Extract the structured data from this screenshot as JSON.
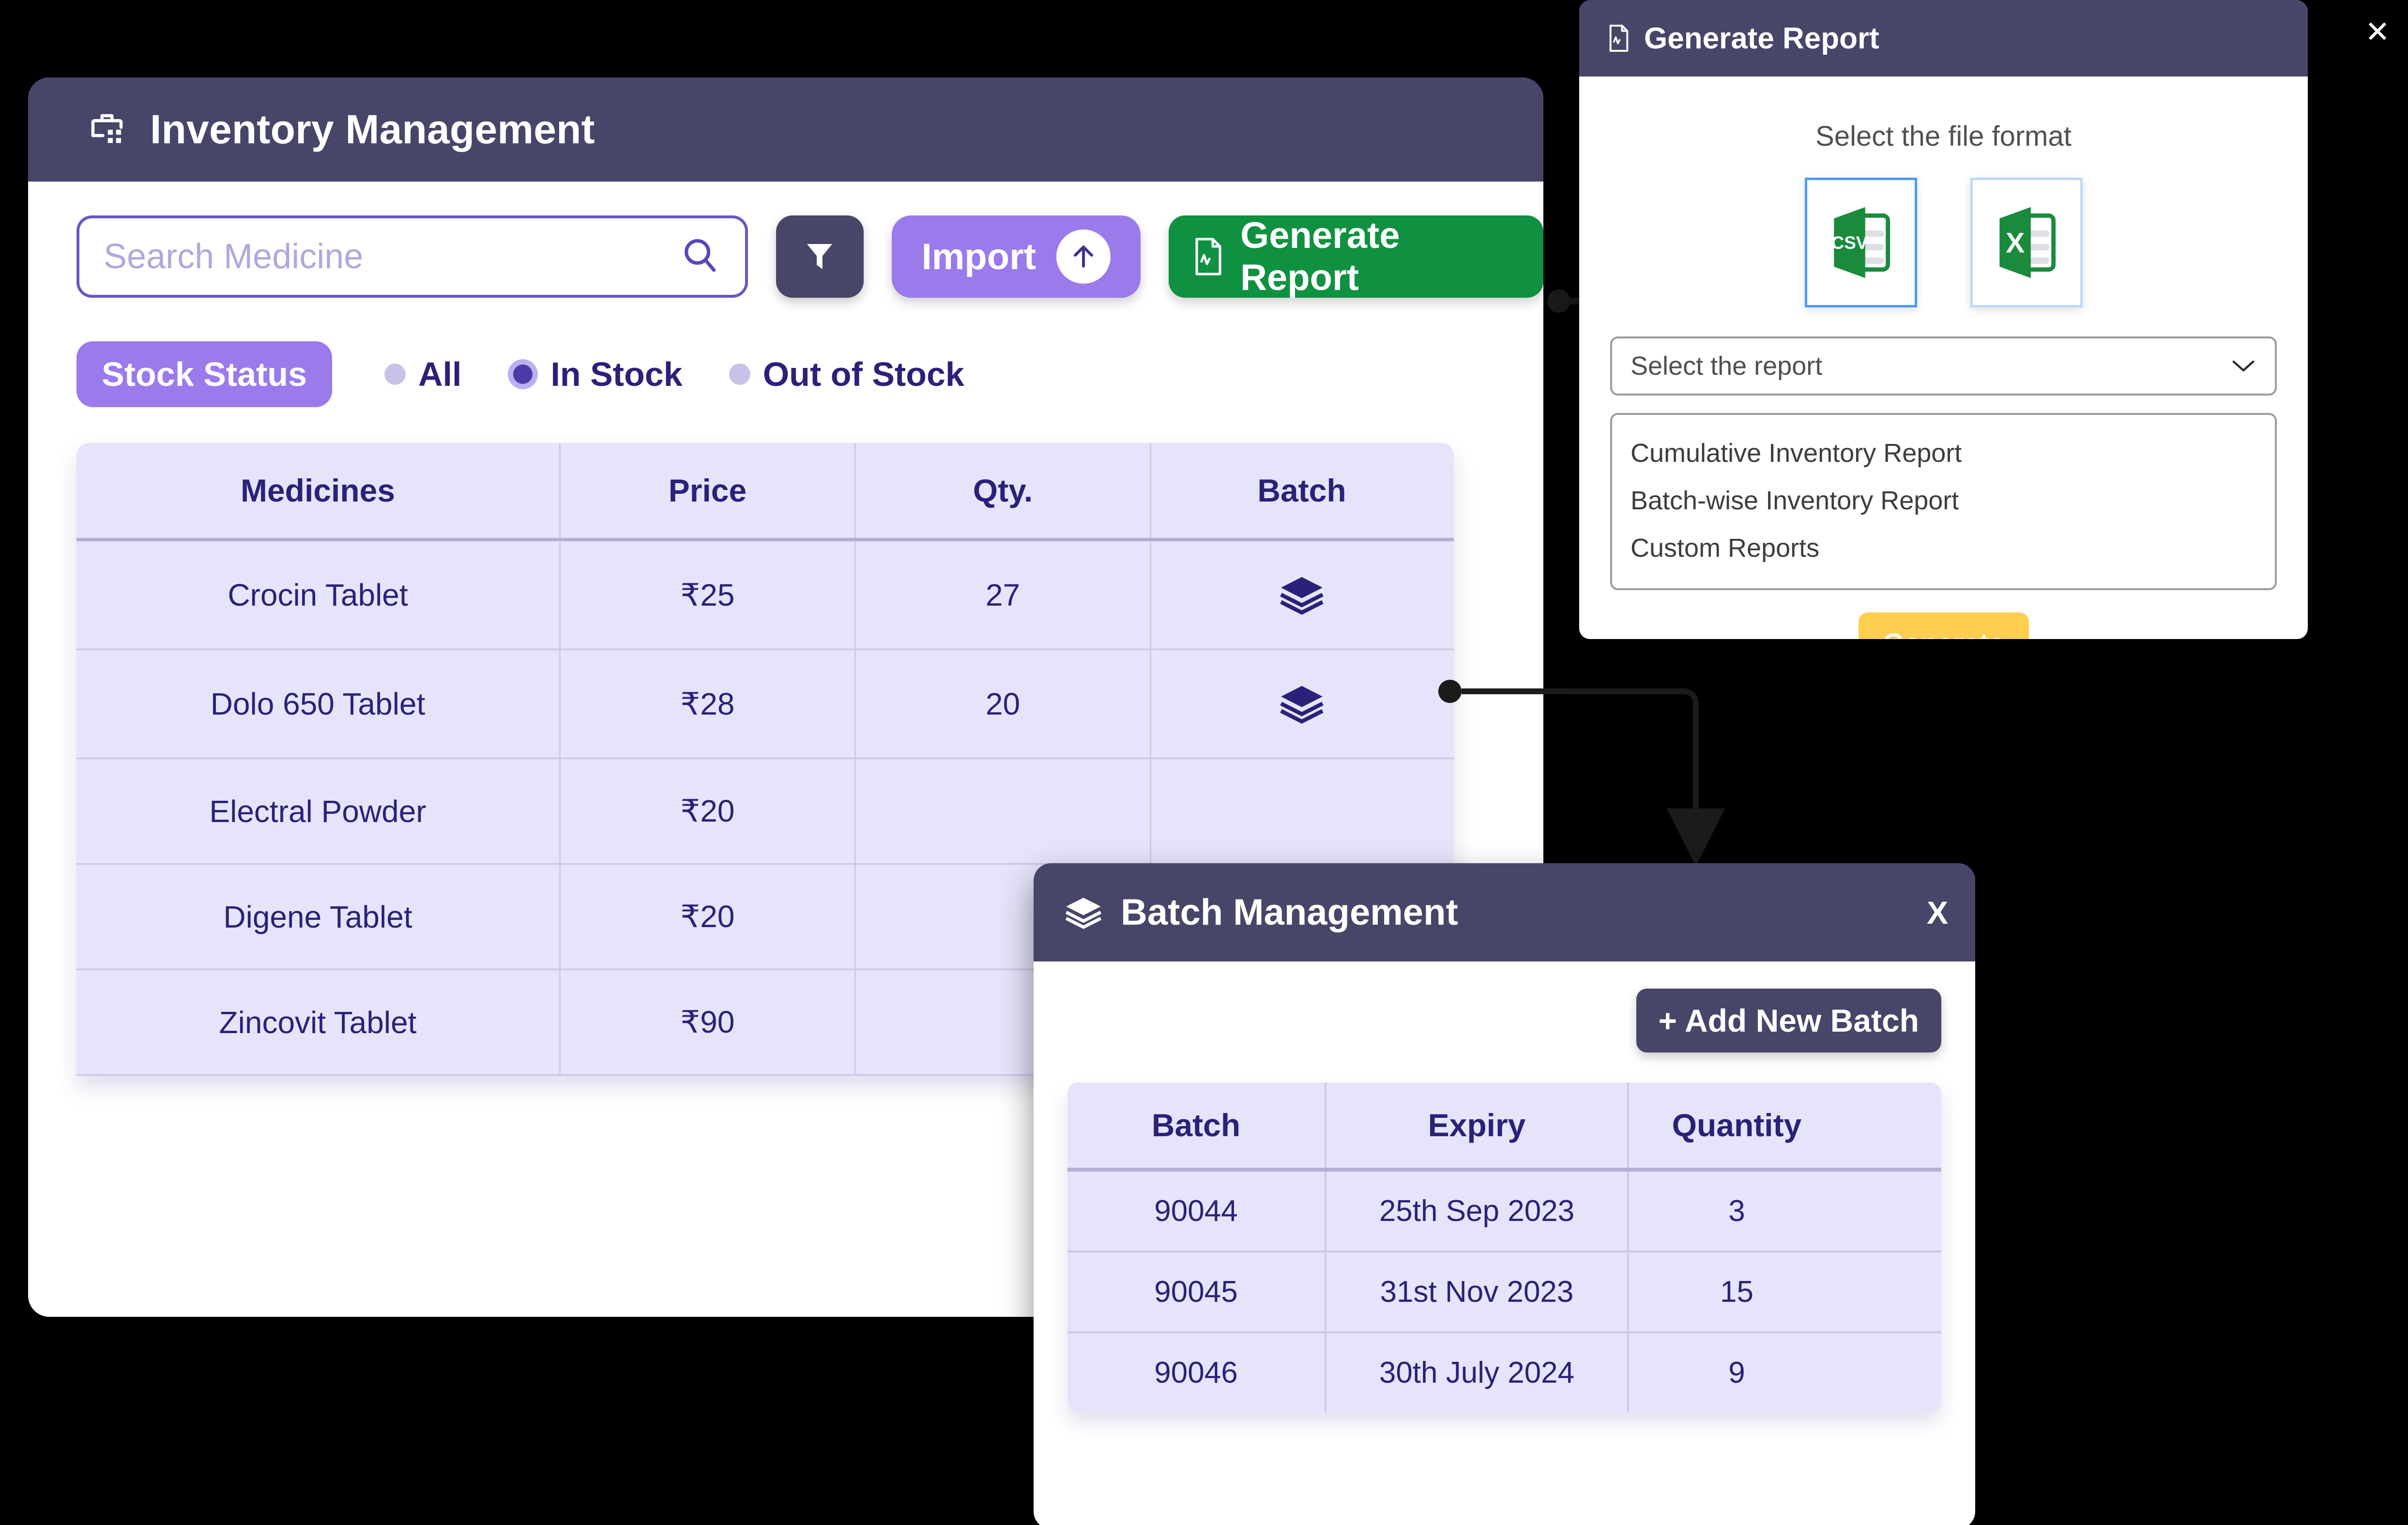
{
  "global": {
    "close_label": "✕",
    "accent_purple": "#6b55c8",
    "accent_light_purple": "#9b7aeb",
    "accent_green": "#109141",
    "accent_dark": "#474668",
    "accent_yellow": "#ffce4f",
    "table_bg": "#e6e4fb",
    "text_indigo": "#2b2178"
  },
  "main_window": {
    "title": "Inventory Management",
    "title_icon": "briefcase-inventory-icon",
    "search": {
      "placeholder": "Search Medicine",
      "value": "",
      "icon": "search-icon"
    },
    "filter_button": {
      "label": "",
      "icon": "filter-funnel-icon"
    },
    "import_button": {
      "label": "Import",
      "icon": "upload-arrow-icon"
    },
    "generate_report_button": {
      "label": "Generate Report",
      "icon": "report-document-icon"
    },
    "stock_status": {
      "pill_label": "Stock Status",
      "options": [
        {
          "label": "All",
          "selected": false
        },
        {
          "label": "In Stock",
          "selected": true
        },
        {
          "label": "Out of Stock",
          "selected": false
        }
      ]
    },
    "inventory_table": {
      "columns": [
        "Medicines",
        "Price",
        "Qty.",
        "Batch"
      ],
      "rows": [
        {
          "medicine": "Crocin Tablet",
          "price": "₹25",
          "qty": "27",
          "batch_icon": "layers-stack-icon"
        },
        {
          "medicine": "Dolo 650 Tablet",
          "price": "₹28",
          "qty": "20",
          "batch_icon": "layers-stack-icon"
        },
        {
          "medicine": "Electral Powder",
          "price": "₹20",
          "qty": "",
          "batch_icon": ""
        },
        {
          "medicine": "Digene Tablet",
          "price": "₹20",
          "qty": "",
          "batch_icon": ""
        },
        {
          "medicine": "Zincovit Tablet",
          "price": "₹90",
          "qty": "",
          "batch_icon": ""
        }
      ]
    }
  },
  "generate_report_panel": {
    "title": "Generate Report",
    "title_icon": "report-document-icon",
    "subtitle": "Select the file format",
    "formats": [
      {
        "label": "CSV",
        "icon": "csv-file-icon",
        "selected": true
      },
      {
        "label": "X",
        "icon": "excel-file-icon",
        "selected": false
      }
    ],
    "select_placeholder": "Select the report",
    "select_icon": "chevron-down-icon",
    "options": [
      "Cumulative Inventory Report",
      "Batch-wise Inventory Report",
      "Custom Reports"
    ],
    "generate_button": "Generate"
  },
  "batch_modal": {
    "title": "Batch Management",
    "title_icon": "layers-stack-icon",
    "close_label": "X",
    "add_button": "+ Add New Batch",
    "table": {
      "columns": [
        "Batch",
        "Expiry",
        "Quantity"
      ],
      "rows": [
        {
          "batch": "90044",
          "expiry": "25th Sep 2023",
          "quantity": "3"
        },
        {
          "batch": "90045",
          "expiry": "31st Nov 2023",
          "quantity": "15"
        },
        {
          "batch": "90046",
          "expiry": "30th July 2024",
          "quantity": "9"
        }
      ]
    }
  }
}
